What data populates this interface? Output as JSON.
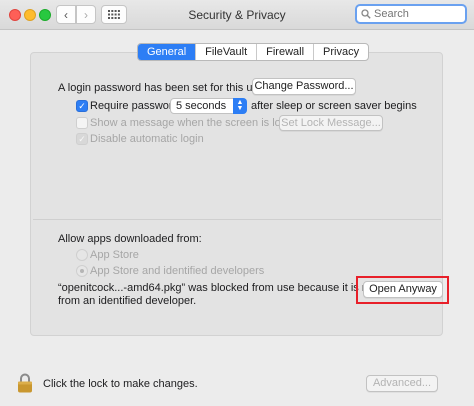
{
  "window": {
    "title": "Security & Privacy"
  },
  "search": {
    "placeholder": "Search"
  },
  "tabs": [
    {
      "label": "General",
      "active": true
    },
    {
      "label": "FileVault",
      "active": false
    },
    {
      "label": "Firewall",
      "active": false
    },
    {
      "label": "Privacy",
      "active": false
    }
  ],
  "general": {
    "login_password_text": "A login password has been set for this user",
    "change_password_label": "Change Password...",
    "require_password_label": "Require password",
    "require_password_checked": true,
    "require_password_delay": "5 seconds",
    "after_sleep_text": "after sleep or screen saver begins",
    "show_message_label": "Show a message when the screen is locked",
    "show_message_checked": false,
    "set_lock_message_label": "Set Lock Message...",
    "disable_auto_login_label": "Disable automatic login",
    "disable_auto_login_checked": true
  },
  "allow_apps": {
    "heading": "Allow apps downloaded from:",
    "options": [
      {
        "label": "App Store",
        "selected": false
      },
      {
        "label": "App Store and identified developers",
        "selected": true
      }
    ],
    "blocked_line1": "“openitcock...-amd64.pkg” was blocked from use because it is not",
    "blocked_line2": "from an identified developer.",
    "open_anyway_label": "Open Anyway"
  },
  "footer": {
    "lock_text": "Click the lock to make changes.",
    "advanced_label": "Advanced..."
  },
  "colors": {
    "accent": "#2d7ef5",
    "highlight_border": "#e8202a",
    "lock_body": "#c9972f"
  },
  "icons": {
    "back": "chevron-left-icon",
    "forward": "chevron-right-icon",
    "grid": "grid-icon",
    "search": "search-icon",
    "lock": "lock-icon"
  }
}
